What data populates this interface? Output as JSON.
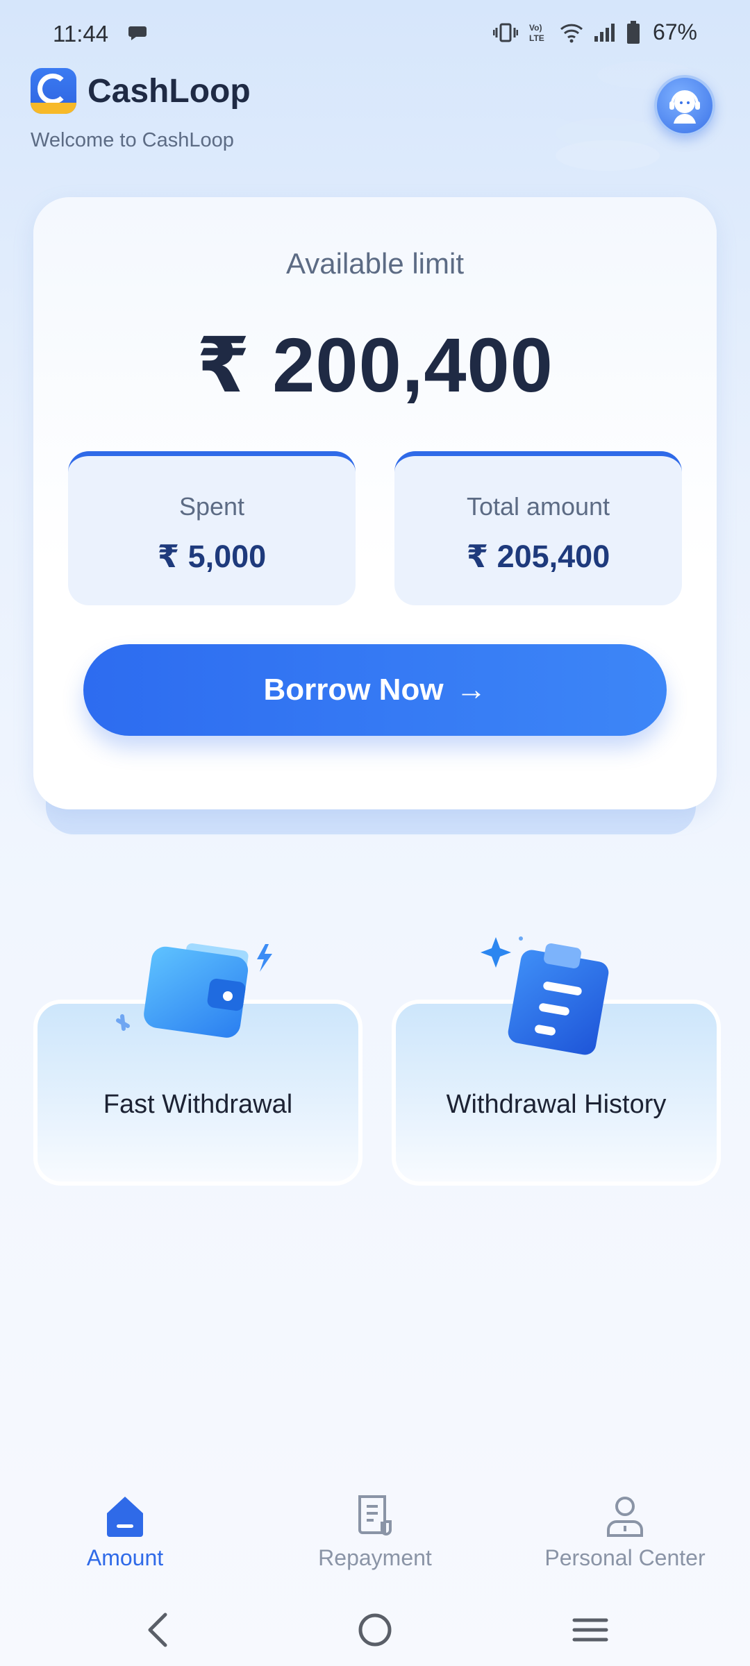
{
  "status_bar": {
    "time": "11:44",
    "battery": "67%",
    "icons": [
      "chat-bubble-icon",
      "vibrate-icon",
      "volte-icon",
      "wifi-icon",
      "signal-icon",
      "battery-icon"
    ]
  },
  "header": {
    "app_name": "CashLoop",
    "logo_text": "CashLoop",
    "welcome": "Welcome to CashLoop",
    "support_icon": "customer-service-icon"
  },
  "limit_card": {
    "label": "Available limit",
    "amount": "₹ 200,400",
    "spent": {
      "label": "Spent",
      "value": "₹ 5,000"
    },
    "total": {
      "label": "Total amount",
      "value": "₹ 205,400"
    },
    "borrow_button": "Borrow Now",
    "borrow_arrow": "→"
  },
  "features": [
    {
      "label": "Fast Withdrawal",
      "icon": "wallet-icon"
    },
    {
      "label": "Withdrawal History",
      "icon": "clipboard-icon"
    }
  ],
  "bottom_nav": [
    {
      "label": "Amount",
      "icon": "home-icon",
      "active": true
    },
    {
      "label": "Repayment",
      "icon": "bill-icon",
      "active": false
    },
    {
      "label": "Personal Center",
      "icon": "person-icon",
      "active": false
    }
  ],
  "colors": {
    "accent": "#2f6ae8",
    "dark_text": "#1f2a44",
    "muted_text": "#5c6b84",
    "inactive_nav": "#8a94a6"
  }
}
